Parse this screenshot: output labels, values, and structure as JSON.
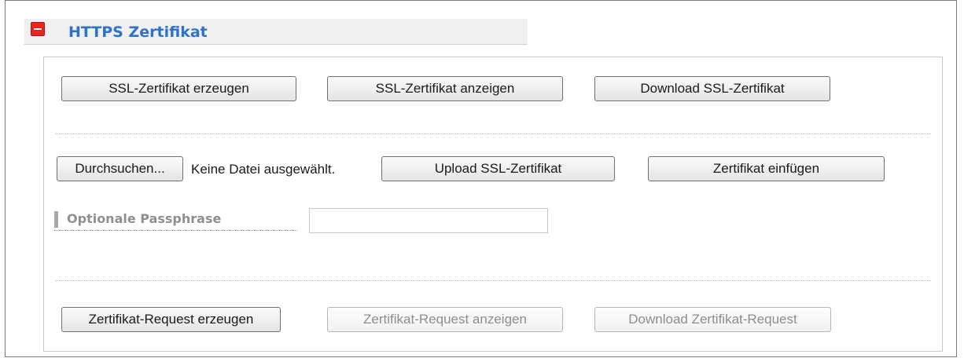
{
  "section": {
    "title": "HTTPS Zertifikat"
  },
  "row1": {
    "create_cert": "SSL-Zertifikat erzeugen",
    "show_cert": "SSL-Zertifikat anzeigen",
    "download_cert": "Download SSL-Zertifikat"
  },
  "row2": {
    "browse": "Durchsuchen...",
    "file_status": "Keine Datei ausgewählt.",
    "upload_cert": "Upload SSL-Zertifikat",
    "insert_cert": "Zertifikat einfügen"
  },
  "passphrase": {
    "label": "Optionale Passphrase",
    "value": ""
  },
  "row3": {
    "create_request": "Zertifikat-Request erzeugen",
    "show_request": "Zertifikat-Request anzeigen",
    "download_request": "Download Zertifikat-Request"
  },
  "colors": {
    "title": "#2f72c9",
    "collapse_icon": "#e8251d"
  }
}
